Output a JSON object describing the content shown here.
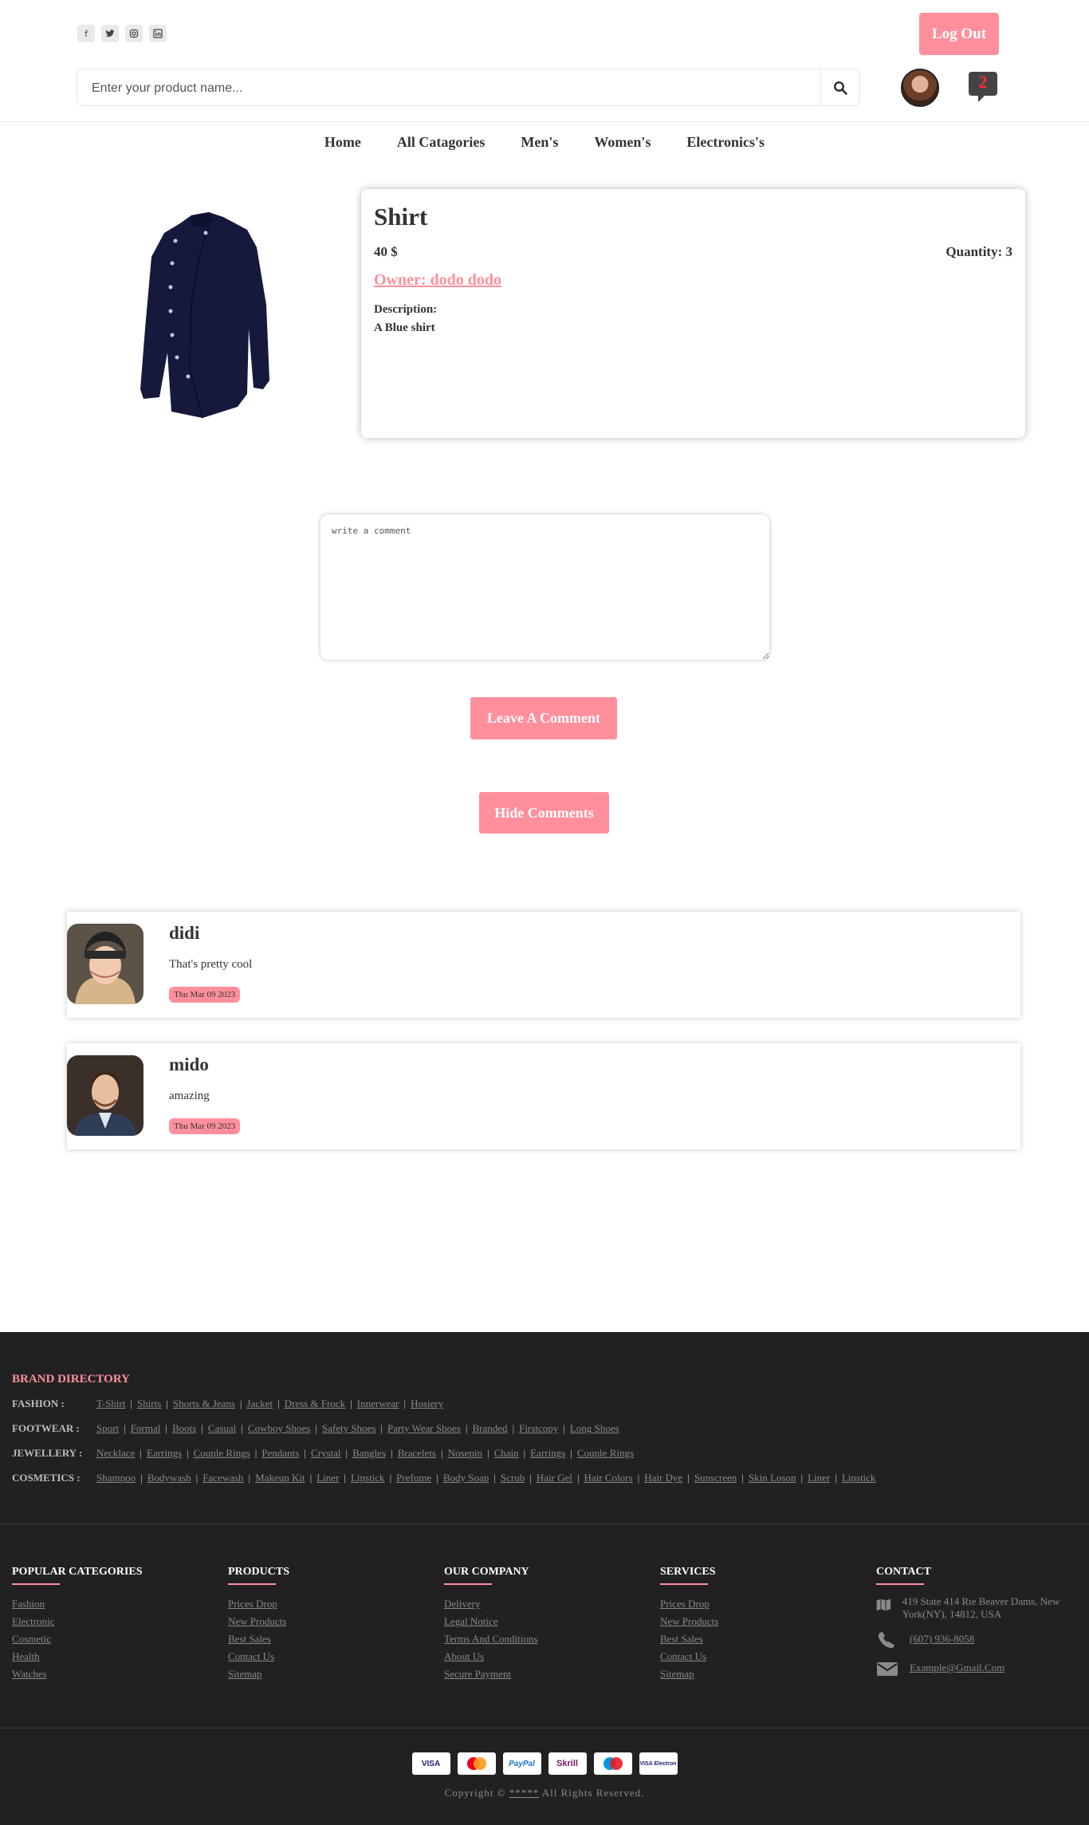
{
  "header": {
    "social": [
      "facebook-icon",
      "twitter-icon",
      "instagram-icon",
      "linkedin-icon"
    ],
    "logout_label": "Log Out",
    "search_placeholder": "Enter your product name...",
    "notification_count": "2"
  },
  "nav": [
    "Home",
    "All Catagories",
    "Men's",
    "Women's",
    "Electronics's"
  ],
  "product": {
    "name": "Shirt",
    "price": "40 $",
    "quantity": "Quantity: 3",
    "owner": "Owner: dodo dodo",
    "description_label": "Description:",
    "description": "A Blue shirt"
  },
  "comment_form": {
    "placeholder": "write a comment",
    "submit_label": "Leave A Comment",
    "toggle_label": "Hide Comments"
  },
  "comments": [
    {
      "name": "didi",
      "text": "That's pretty cool",
      "date": "Thu Mar 09 2023"
    },
    {
      "name": "mido",
      "text": "amazing",
      "date": "Thu Mar 09 2023"
    }
  ],
  "footer": {
    "brand_directory_title": "BRAND DIRECTORY",
    "directory": [
      {
        "label": "FASHION :",
        "items": [
          "T-Shirt",
          "Shirts",
          "Shorts & Jeans",
          "Jacket",
          "Dress & Frock",
          "Innerwear",
          "Hosiery"
        ]
      },
      {
        "label": "FOOTWEAR :",
        "items": [
          "Sport",
          "Formal",
          "Boots",
          "Casual",
          "Cowboy Shoes",
          "Safety Shoes",
          "Party Wear Shoes",
          "Branded",
          "Firstcopy",
          "Long Shoes"
        ]
      },
      {
        "label": "JEWELLERY :",
        "items": [
          "Necklace",
          "Earrings",
          "Couple Rings",
          "Pendants",
          "Crystal",
          "Bangles",
          "Bracelets",
          "Nosepin",
          "Chain",
          "Earrings",
          "Couple Rings"
        ]
      },
      {
        "label": "COSMETICS :",
        "items": [
          "Shampoo",
          "Bodywash",
          "Facewash",
          "Makeup Kit",
          "Liner",
          "Lipstick",
          "Prefume",
          "Body Soap",
          "Scrub",
          "Hair Gel",
          "Hair Colors",
          "Hair Dye",
          "Sunscreen",
          "Skin Loson",
          "Liner",
          "Lipstick"
        ]
      }
    ],
    "columns": [
      {
        "title": "POPULAR CATEGORIES",
        "links": [
          "Fashion",
          "Electronic",
          "Cosmetic",
          "Health",
          "Watches"
        ]
      },
      {
        "title": "PRODUCTS",
        "links": [
          "Prices Drop",
          "New Products",
          "Best Sales",
          "Contact Us",
          "Sitemap"
        ]
      },
      {
        "title": "OUR COMPANY",
        "links": [
          "Delivery",
          "Legal Notice",
          "Terms And Conditions",
          "About Us",
          "Secure Payment"
        ]
      },
      {
        "title": "SERVICES",
        "links": [
          "Prices Drop",
          "New Products",
          "Best Sales",
          "Contact Us",
          "Sitemap"
        ]
      }
    ],
    "contact": {
      "title": "CONTACT",
      "address": "419 State 414 Rte Beaver Dams, New York(NY), 14812, USA",
      "phone": "(607) 936-8058",
      "email": "Example@Gmail.Com"
    },
    "payment_cards": [
      "VISA",
      "Mastercard",
      "PayPal",
      "Skrill",
      "Maestro",
      "VISA Electron"
    ],
    "copyright_prefix": "Copyright © ",
    "copyright_link": "*****",
    "copyright_suffix": " All Rights Reserved."
  }
}
